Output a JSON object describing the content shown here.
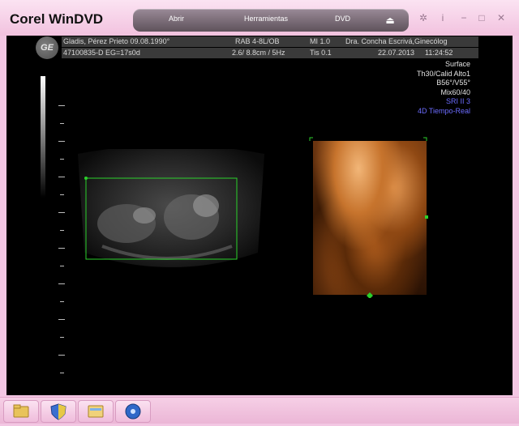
{
  "window": {
    "title": "Corel WinDVD",
    "menu": {
      "open": "Abrir",
      "tools": "Herramientas",
      "dvd": "DVD"
    },
    "controls": [
      "✲",
      "i",
      "−",
      "□",
      "✕"
    ]
  },
  "ultrasound": {
    "logo": "GE",
    "header_row1": {
      "patient": "Gladis, Pérez  Prieto 09.08.1990°",
      "probe": "RAB 4-8L/OB",
      "mi": "MI  1.0",
      "doctor": "Dra. Concha Escrivá,Ginecólog"
    },
    "header_row2": {
      "patient_id": "47100835-D  EG=17s0d",
      "depth": "2.6/ 8.8cm / 5Hz",
      "tis": "Tis  0.1",
      "date": "22.07.2013",
      "time": "11:24:52"
    },
    "params": [
      "Surface",
      "Th30/Calid Alto1",
      "B56°/V55°",
      "Mix60/40"
    ],
    "params_blue": [
      "SRI II 3",
      "4D Tiempo-Real"
    ]
  },
  "colors": {
    "window_chrome": "#f3c7e3",
    "menu_pill": "#6b5f68",
    "roi_box": "#2bd12b",
    "render_orange": "#c7742d"
  }
}
